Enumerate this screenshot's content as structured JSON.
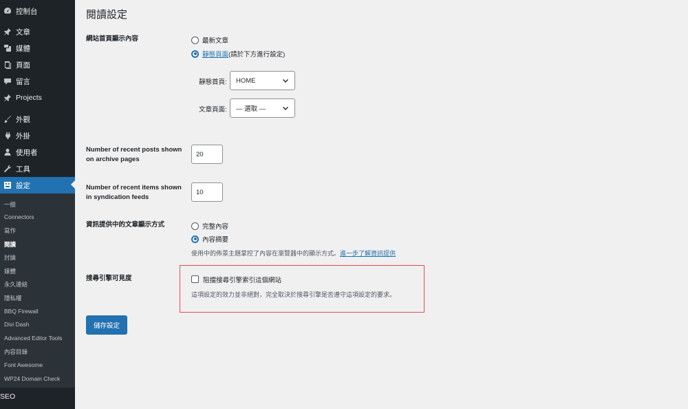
{
  "sidebar": {
    "items": [
      {
        "label": "控制台",
        "icon": "dashboard-icon"
      },
      {
        "label": "文章",
        "icon": "pin-icon"
      },
      {
        "label": "媒體",
        "icon": "media-icon"
      },
      {
        "label": "頁面",
        "icon": "page-icon"
      },
      {
        "label": "留言",
        "icon": "comment-icon"
      },
      {
        "label": "Projects",
        "icon": "pin-icon"
      },
      {
        "label": "外觀",
        "icon": "brush-icon"
      },
      {
        "label": "外掛",
        "icon": "plugin-icon"
      },
      {
        "label": "使用者",
        "icon": "user-icon"
      },
      {
        "label": "工具",
        "icon": "wrench-icon"
      },
      {
        "label": "設定",
        "icon": "settings-icon"
      }
    ],
    "submenu": [
      "一般",
      "Connectors",
      "寫作",
      "閱讀",
      "討論",
      "媒體",
      "永久連結",
      "隱私權",
      "BBQ Firewall",
      "Divi Dash",
      "Advanced Editor Tools",
      "內容目錄",
      "Font Awesome",
      "WP24 Domain Check"
    ],
    "active_submenu": "閱讀",
    "seo": "SEO"
  },
  "page": {
    "title": "閱讀設定"
  },
  "homepage": {
    "label": "網站首頁顯示內容",
    "option_latest": "最新文章",
    "option_static_link": "靜態頁面",
    "option_static_suffix": " (請於下方進行設定)",
    "front_label": "靜態首頁:",
    "front_value": "HOME",
    "posts_label": "文章頁面:",
    "posts_value": "— 選取 —"
  },
  "posts_per_page": {
    "label": "Number of recent posts shown on archive pages",
    "value": "20"
  },
  "feed_items": {
    "label": "Number of recent items shown in syndication feeds",
    "value": "10"
  },
  "feed_content": {
    "label": "資訊提供中的文章顯示方式",
    "option_full": "完整內容",
    "option_excerpt": "內容摘要",
    "desc_prefix": "使用中的佈景主題掌控了內容在瀏覽器中的顯示方式。",
    "desc_link": "進一步了解資訊提供"
  },
  "visibility": {
    "label": "搜尋引擎可見度",
    "checkbox_label": "阻擋搜尋引擎索引這個網站",
    "desc": "這項設定的效力並非絕對，完全取決於搜尋引擎是否遵守這項設定的要求。"
  },
  "save_button": "儲存設定",
  "colors": {
    "accent": "#2271b1",
    "sidebar_bg": "#1d2327",
    "highlight_border": "#e44a4a"
  }
}
